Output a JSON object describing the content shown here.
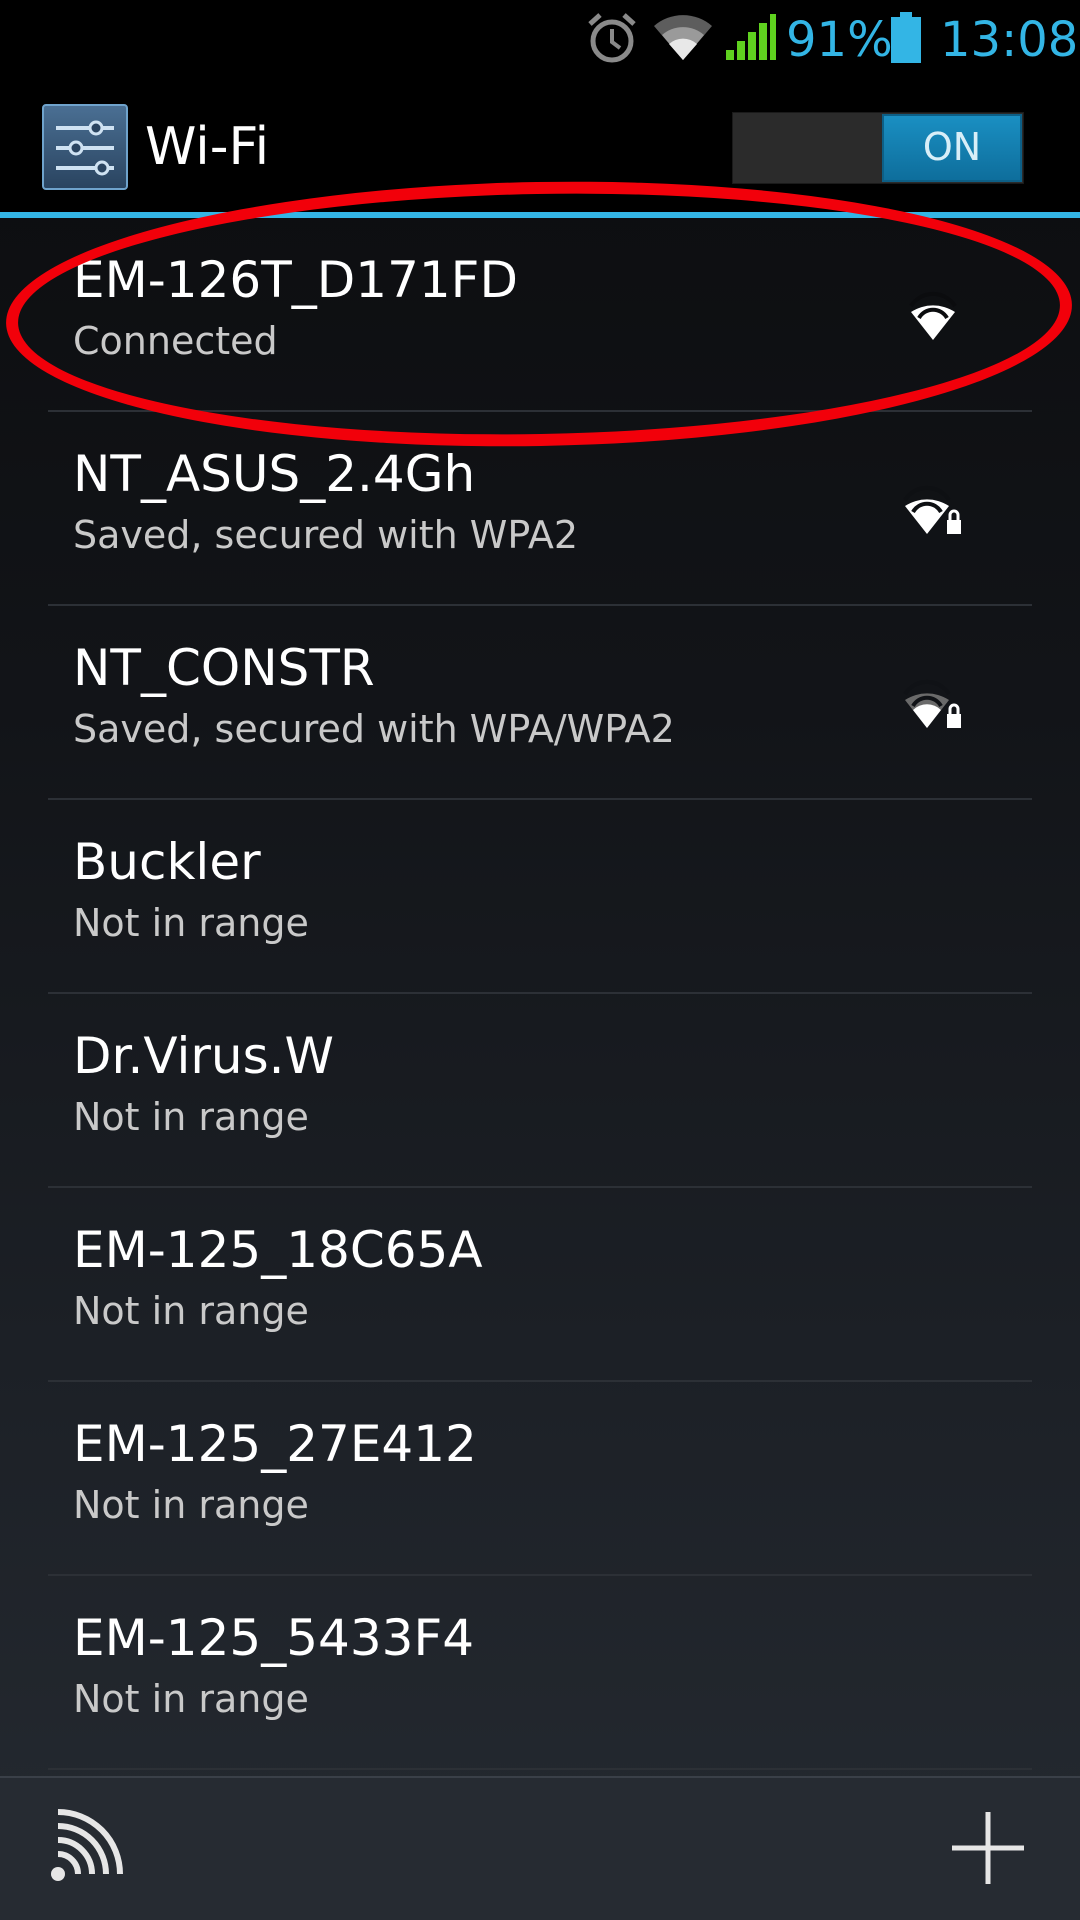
{
  "status_bar": {
    "battery_percent": "91%",
    "battery_level": 0.91,
    "time": "13:08",
    "accent_color": "#33b5e5",
    "icons": [
      "alarm-icon",
      "wifi-status-icon",
      "cell-signal-icon",
      "battery-icon"
    ]
  },
  "action_bar": {
    "title": "Wi-Fi",
    "app_icon": "settings-sliders-icon",
    "toggle_label": "ON",
    "toggle_state": "on"
  },
  "networks": [
    {
      "name": "EM-126T_D171FD",
      "status": "Connected",
      "signal_icon": "wifi-signal-full-icon",
      "secured": false,
      "highlighted": true
    },
    {
      "name": "NT_ASUS_2.4Gh",
      "status": "Saved, secured with WPA2",
      "signal_icon": "wifi-signal-locked-icon",
      "secured": true
    },
    {
      "name": "NT_CONSTR",
      "status": "Saved, secured with WPA/WPA2",
      "signal_icon": "wifi-signal-weak-locked-icon",
      "secured": true
    },
    {
      "name": "Buckler",
      "status": "Not in range"
    },
    {
      "name": "Dr.Virus.W",
      "status": "Not in range"
    },
    {
      "name": "EM-125_18C65A",
      "status": "Not in range"
    },
    {
      "name": "EM-125_27E412",
      "status": "Not in range"
    },
    {
      "name": "EM-125_5433F4",
      "status": "Not in range"
    }
  ],
  "highlight_color": "#f2000a",
  "bottom_bar": {
    "icons": [
      "wps-icon",
      "add-network-icon"
    ]
  }
}
